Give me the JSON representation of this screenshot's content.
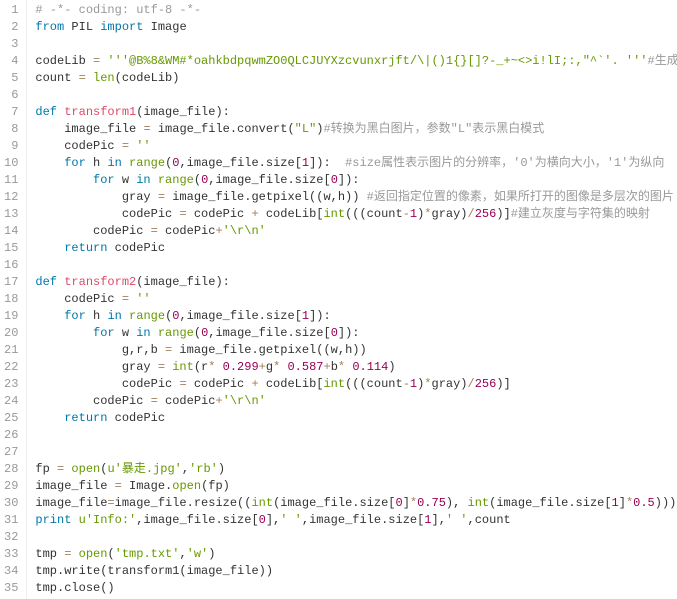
{
  "lines": [
    [
      {
        "c": "tok-comment",
        "t": "# -*- coding: utf-8 -*-"
      }
    ],
    [
      {
        "c": "tok-kw",
        "t": "from"
      },
      {
        "c": "",
        "t": " PIL "
      },
      {
        "c": "tok-kw",
        "t": "import"
      },
      {
        "c": "",
        "t": " Image"
      }
    ],
    [],
    [
      {
        "c": "",
        "t": "codeLib "
      },
      {
        "c": "tok-op",
        "t": "="
      },
      {
        "c": "",
        "t": " "
      },
      {
        "c": "tok-str",
        "t": "'''@B%8&WM#*oahkbdpqwmZO0QLCJUYXzcvunxrjft/\\|()1{}[]?-_+~<>i!lI;:,\"^`'. '''"
      },
      {
        "c": "tok-comment",
        "t": "#生成"
      }
    ],
    [
      {
        "c": "",
        "t": "count "
      },
      {
        "c": "tok-op",
        "t": "="
      },
      {
        "c": "",
        "t": " "
      },
      {
        "c": "tok-builtin",
        "t": "len"
      },
      {
        "c": "",
        "t": "(codeLib)"
      }
    ],
    [],
    [
      {
        "c": "tok-kw",
        "t": "def"
      },
      {
        "c": "",
        "t": " "
      },
      {
        "c": "tok-def",
        "t": "transform1"
      },
      {
        "c": "",
        "t": "(image_file):"
      }
    ],
    [
      {
        "c": "",
        "t": "    image_file "
      },
      {
        "c": "tok-op",
        "t": "="
      },
      {
        "c": "",
        "t": " image_file.convert("
      },
      {
        "c": "tok-str",
        "t": "\"L\""
      },
      {
        "c": "",
        "t": ")"
      },
      {
        "c": "tok-comment",
        "t": "#转换为黑白图片，参数\"L\"表示黑白模式"
      }
    ],
    [
      {
        "c": "",
        "t": "    codePic "
      },
      {
        "c": "tok-op",
        "t": "="
      },
      {
        "c": "",
        "t": " "
      },
      {
        "c": "tok-str",
        "t": "''"
      }
    ],
    [
      {
        "c": "",
        "t": "    "
      },
      {
        "c": "tok-kw",
        "t": "for"
      },
      {
        "c": "",
        "t": " h "
      },
      {
        "c": "tok-kw",
        "t": "in"
      },
      {
        "c": "",
        "t": " "
      },
      {
        "c": "tok-builtin",
        "t": "range"
      },
      {
        "c": "",
        "t": "("
      },
      {
        "c": "tok-num",
        "t": "0"
      },
      {
        "c": "",
        "t": ",image_file.size["
      },
      {
        "c": "tok-num",
        "t": "1"
      },
      {
        "c": "",
        "t": "]):  "
      },
      {
        "c": "tok-comment",
        "t": "#size属性表示图片的分辨率，'0'为横向大小，'1'为纵向"
      }
    ],
    [
      {
        "c": "",
        "t": "        "
      },
      {
        "c": "tok-kw",
        "t": "for"
      },
      {
        "c": "",
        "t": " w "
      },
      {
        "c": "tok-kw",
        "t": "in"
      },
      {
        "c": "",
        "t": " "
      },
      {
        "c": "tok-builtin",
        "t": "range"
      },
      {
        "c": "",
        "t": "("
      },
      {
        "c": "tok-num",
        "t": "0"
      },
      {
        "c": "",
        "t": ",image_file.size["
      },
      {
        "c": "tok-num",
        "t": "0"
      },
      {
        "c": "",
        "t": "]):"
      }
    ],
    [
      {
        "c": "",
        "t": "            gray "
      },
      {
        "c": "tok-op",
        "t": "="
      },
      {
        "c": "",
        "t": " image_file.getpixel((w,h)) "
      },
      {
        "c": "tok-comment",
        "t": "#返回指定位置的像素，如果所打开的图像是多层次的图片"
      }
    ],
    [
      {
        "c": "",
        "t": "            codePic "
      },
      {
        "c": "tok-op",
        "t": "="
      },
      {
        "c": "",
        "t": " codePic "
      },
      {
        "c": "tok-op",
        "t": "+"
      },
      {
        "c": "",
        "t": " codeLib["
      },
      {
        "c": "tok-builtin",
        "t": "int"
      },
      {
        "c": "",
        "t": "(((count"
      },
      {
        "c": "tok-op",
        "t": "-"
      },
      {
        "c": "tok-num",
        "t": "1"
      },
      {
        "c": "",
        "t": ")"
      },
      {
        "c": "tok-op",
        "t": "*"
      },
      {
        "c": "",
        "t": "gray)"
      },
      {
        "c": "tok-op",
        "t": "/"
      },
      {
        "c": "tok-num",
        "t": "256"
      },
      {
        "c": "",
        "t": ")]"
      },
      {
        "c": "tok-comment",
        "t": "#建立灰度与字符集的映射"
      }
    ],
    [
      {
        "c": "",
        "t": "        codePic "
      },
      {
        "c": "tok-op",
        "t": "="
      },
      {
        "c": "",
        "t": " codePic"
      },
      {
        "c": "tok-op",
        "t": "+"
      },
      {
        "c": "tok-str",
        "t": "'\\r\\n'"
      }
    ],
    [
      {
        "c": "",
        "t": "    "
      },
      {
        "c": "tok-kw",
        "t": "return"
      },
      {
        "c": "",
        "t": " codePic"
      }
    ],
    [],
    [
      {
        "c": "tok-kw",
        "t": "def"
      },
      {
        "c": "",
        "t": " "
      },
      {
        "c": "tok-def",
        "t": "transform2"
      },
      {
        "c": "",
        "t": "(image_file):"
      }
    ],
    [
      {
        "c": "",
        "t": "    codePic "
      },
      {
        "c": "tok-op",
        "t": "="
      },
      {
        "c": "",
        "t": " "
      },
      {
        "c": "tok-str",
        "t": "''"
      }
    ],
    [
      {
        "c": "",
        "t": "    "
      },
      {
        "c": "tok-kw",
        "t": "for"
      },
      {
        "c": "",
        "t": " h "
      },
      {
        "c": "tok-kw",
        "t": "in"
      },
      {
        "c": "",
        "t": " "
      },
      {
        "c": "tok-builtin",
        "t": "range"
      },
      {
        "c": "",
        "t": "("
      },
      {
        "c": "tok-num",
        "t": "0"
      },
      {
        "c": "",
        "t": ",image_file.size["
      },
      {
        "c": "tok-num",
        "t": "1"
      },
      {
        "c": "",
        "t": "]):"
      }
    ],
    [
      {
        "c": "",
        "t": "        "
      },
      {
        "c": "tok-kw",
        "t": "for"
      },
      {
        "c": "",
        "t": " w "
      },
      {
        "c": "tok-kw",
        "t": "in"
      },
      {
        "c": "",
        "t": " "
      },
      {
        "c": "tok-builtin",
        "t": "range"
      },
      {
        "c": "",
        "t": "("
      },
      {
        "c": "tok-num",
        "t": "0"
      },
      {
        "c": "",
        "t": ",image_file.size["
      },
      {
        "c": "tok-num",
        "t": "0"
      },
      {
        "c": "",
        "t": "]):"
      }
    ],
    [
      {
        "c": "",
        "t": "            g,r,b "
      },
      {
        "c": "tok-op",
        "t": "="
      },
      {
        "c": "",
        "t": " image_file.getpixel((w,h))"
      }
    ],
    [
      {
        "c": "",
        "t": "            gray "
      },
      {
        "c": "tok-op",
        "t": "="
      },
      {
        "c": "",
        "t": " "
      },
      {
        "c": "tok-builtin",
        "t": "int"
      },
      {
        "c": "",
        "t": "(r"
      },
      {
        "c": "tok-op",
        "t": "*"
      },
      {
        "c": "",
        "t": " "
      },
      {
        "c": "tok-num",
        "t": "0.299"
      },
      {
        "c": "tok-op",
        "t": "+"
      },
      {
        "c": "",
        "t": "g"
      },
      {
        "c": "tok-op",
        "t": "*"
      },
      {
        "c": "",
        "t": " "
      },
      {
        "c": "tok-num",
        "t": "0.587"
      },
      {
        "c": "tok-op",
        "t": "+"
      },
      {
        "c": "",
        "t": "b"
      },
      {
        "c": "tok-op",
        "t": "*"
      },
      {
        "c": "",
        "t": " "
      },
      {
        "c": "tok-num",
        "t": "0.114"
      },
      {
        "c": "",
        "t": ")"
      }
    ],
    [
      {
        "c": "",
        "t": "            codePic "
      },
      {
        "c": "tok-op",
        "t": "="
      },
      {
        "c": "",
        "t": " codePic "
      },
      {
        "c": "tok-op",
        "t": "+"
      },
      {
        "c": "",
        "t": " codeLib["
      },
      {
        "c": "tok-builtin",
        "t": "int"
      },
      {
        "c": "",
        "t": "(((count"
      },
      {
        "c": "tok-op",
        "t": "-"
      },
      {
        "c": "tok-num",
        "t": "1"
      },
      {
        "c": "",
        "t": ")"
      },
      {
        "c": "tok-op",
        "t": "*"
      },
      {
        "c": "",
        "t": "gray)"
      },
      {
        "c": "tok-op",
        "t": "/"
      },
      {
        "c": "tok-num",
        "t": "256"
      },
      {
        "c": "",
        "t": ")]"
      }
    ],
    [
      {
        "c": "",
        "t": "        codePic "
      },
      {
        "c": "tok-op",
        "t": "="
      },
      {
        "c": "",
        "t": " codePic"
      },
      {
        "c": "tok-op",
        "t": "+"
      },
      {
        "c": "tok-str",
        "t": "'\\r\\n'"
      }
    ],
    [
      {
        "c": "",
        "t": "    "
      },
      {
        "c": "tok-kw",
        "t": "return"
      },
      {
        "c": "",
        "t": " codePic"
      }
    ],
    [],
    [],
    [
      {
        "c": "",
        "t": "fp "
      },
      {
        "c": "tok-op",
        "t": "="
      },
      {
        "c": "",
        "t": " "
      },
      {
        "c": "tok-builtin",
        "t": "open"
      },
      {
        "c": "",
        "t": "("
      },
      {
        "c": "tok-str",
        "t": "u'暴走.jpg'"
      },
      {
        "c": "",
        "t": ","
      },
      {
        "c": "tok-str",
        "t": "'rb'"
      },
      {
        "c": "",
        "t": ")"
      }
    ],
    [
      {
        "c": "",
        "t": "image_file "
      },
      {
        "c": "tok-op",
        "t": "="
      },
      {
        "c": "",
        "t": " Image."
      },
      {
        "c": "tok-builtin",
        "t": "open"
      },
      {
        "c": "",
        "t": "(fp)"
      }
    ],
    [
      {
        "c": "",
        "t": "image_file"
      },
      {
        "c": "tok-op",
        "t": "="
      },
      {
        "c": "",
        "t": "image_file.resize(("
      },
      {
        "c": "tok-builtin",
        "t": "int"
      },
      {
        "c": "",
        "t": "(image_file.size["
      },
      {
        "c": "tok-num",
        "t": "0"
      },
      {
        "c": "",
        "t": "]"
      },
      {
        "c": "tok-op",
        "t": "*"
      },
      {
        "c": "tok-num",
        "t": "0.75"
      },
      {
        "c": "",
        "t": "), "
      },
      {
        "c": "tok-builtin",
        "t": "int"
      },
      {
        "c": "",
        "t": "(image_file.size["
      },
      {
        "c": "tok-num",
        "t": "1"
      },
      {
        "c": "",
        "t": "]"
      },
      {
        "c": "tok-op",
        "t": "*"
      },
      {
        "c": "tok-num",
        "t": "0.5"
      },
      {
        "c": "",
        "t": ")))"
      }
    ],
    [
      {
        "c": "tok-kw",
        "t": "print"
      },
      {
        "c": "",
        "t": " "
      },
      {
        "c": "tok-str",
        "t": "u'Info:'"
      },
      {
        "c": "",
        "t": ",image_file.size["
      },
      {
        "c": "tok-num",
        "t": "0"
      },
      {
        "c": "",
        "t": "],"
      },
      {
        "c": "tok-str",
        "t": "' '"
      },
      {
        "c": "",
        "t": ",image_file.size["
      },
      {
        "c": "tok-num",
        "t": "1"
      },
      {
        "c": "",
        "t": "],"
      },
      {
        "c": "tok-str",
        "t": "' '"
      },
      {
        "c": "",
        "t": ",count"
      }
    ],
    [],
    [
      {
        "c": "",
        "t": "tmp "
      },
      {
        "c": "tok-op",
        "t": "="
      },
      {
        "c": "",
        "t": " "
      },
      {
        "c": "tok-builtin",
        "t": "open"
      },
      {
        "c": "",
        "t": "("
      },
      {
        "c": "tok-str",
        "t": "'tmp.txt'"
      },
      {
        "c": "",
        "t": ","
      },
      {
        "c": "tok-str",
        "t": "'w'"
      },
      {
        "c": "",
        "t": ")"
      }
    ],
    [
      {
        "c": "",
        "t": "tmp.write(transform1(image_file))"
      }
    ],
    [
      {
        "c": "",
        "t": "tmp.close()"
      }
    ]
  ],
  "line_count": 35
}
